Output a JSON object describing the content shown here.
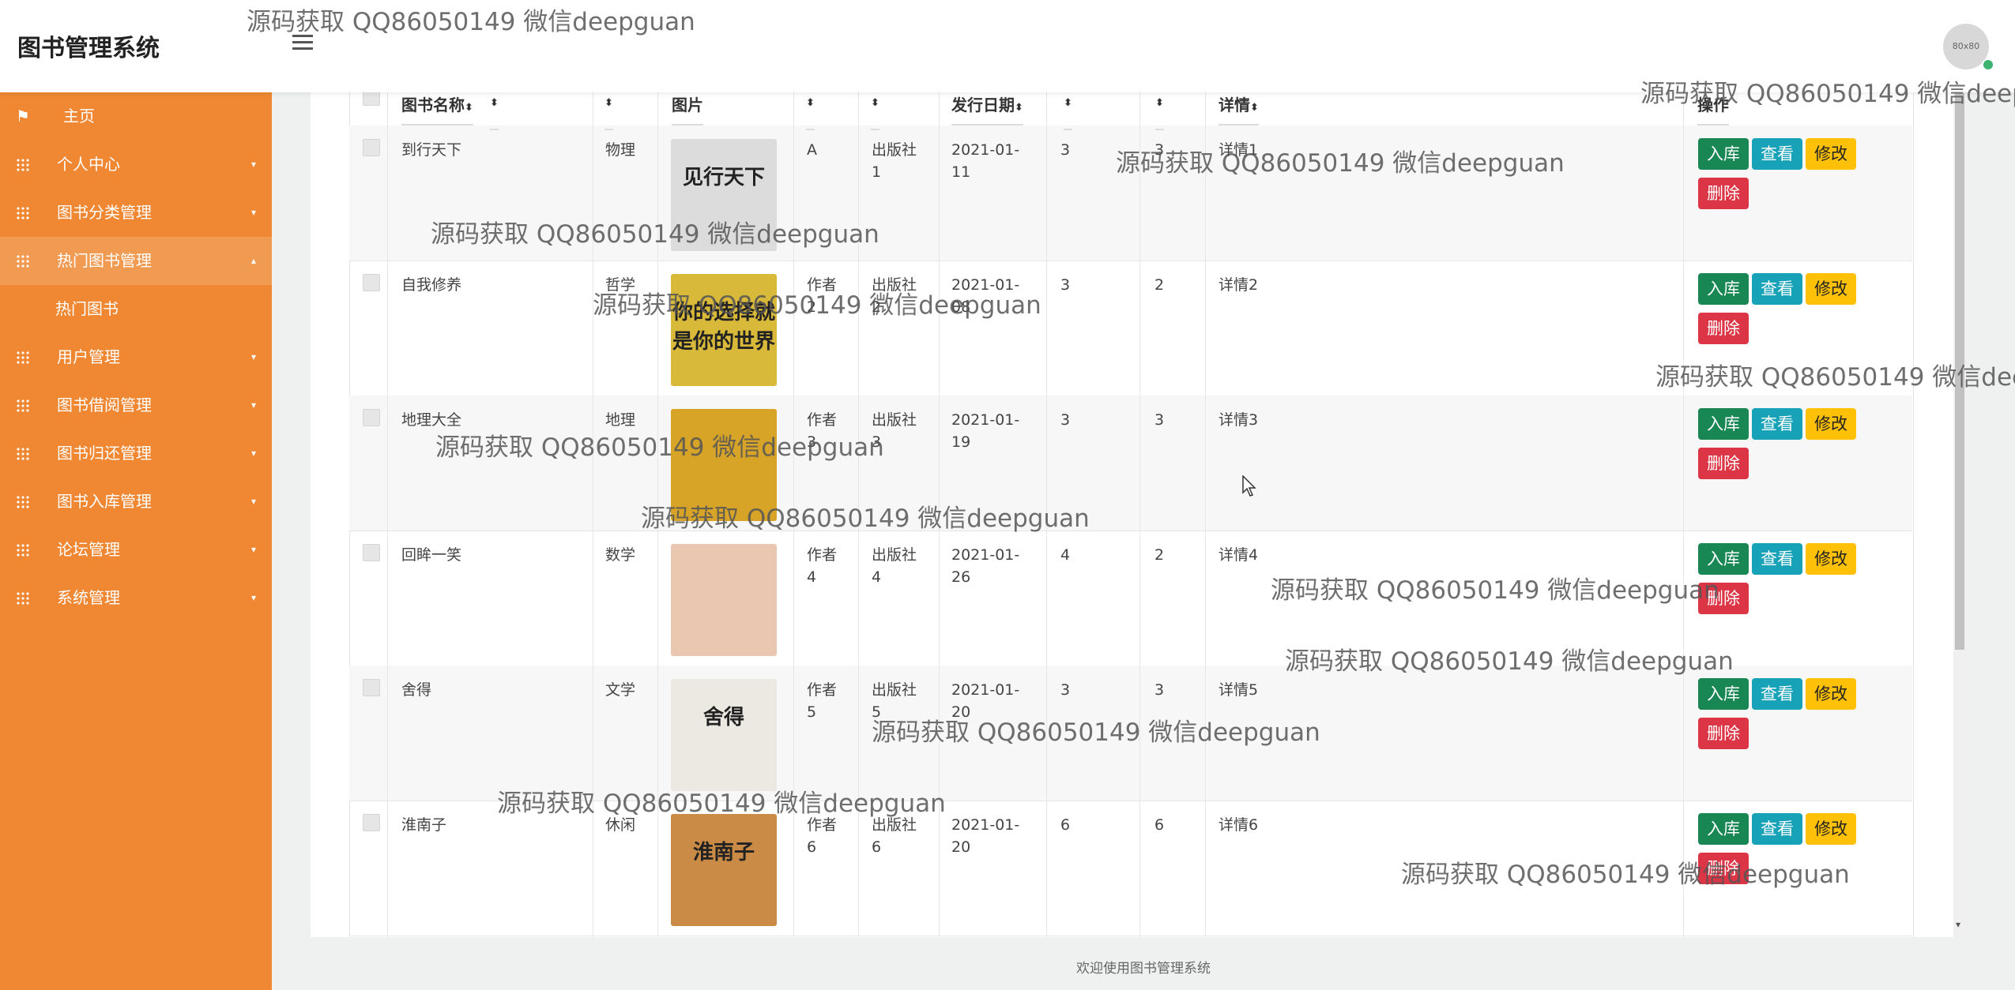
{
  "header": {
    "app_title": "图书管理系统",
    "avatar_text": "80x80"
  },
  "sidebar": {
    "items": [
      {
        "label": "主页"
      },
      {
        "label": "个人中心"
      },
      {
        "label": "图书分类管理"
      },
      {
        "label": "热门图书管理",
        "sub": "热门图书"
      },
      {
        "label": "用户管理"
      },
      {
        "label": "图书借阅管理"
      },
      {
        "label": "图书归还管理"
      },
      {
        "label": "图书入库管理"
      },
      {
        "label": "论坛管理"
      },
      {
        "label": "系统管理"
      }
    ]
  },
  "table": {
    "columns": [
      "图书名称",
      "",
      "图片",
      "",
      "",
      "发行日期",
      "",
      "",
      "详情",
      "操作"
    ],
    "rows": [
      {
        "name": "到行天下",
        "category": "物理",
        "author": "A",
        "publisher": "出版社\n1",
        "date": "2021-01-\n11",
        "n1": "3",
        "n2": "3",
        "detail": "详情1"
      },
      {
        "name": "自我修养",
        "category": "哲学",
        "author": "作者\n2",
        "publisher": "出版社\n2",
        "date": "2021-01-\n08",
        "n1": "3",
        "n2": "2",
        "detail": "详情2"
      },
      {
        "name": "地理大全",
        "category": "地理",
        "author": "作者\n3",
        "publisher": "出版社\n3",
        "date": "2021-01-\n19",
        "n1": "3",
        "n2": "3",
        "detail": "详情3"
      },
      {
        "name": "回眸一笑",
        "category": "数学",
        "author": "作者\n4",
        "publisher": "出版社\n4",
        "date": "2021-01-\n26",
        "n1": "4",
        "n2": "2",
        "detail": "详情4"
      },
      {
        "name": "舍得",
        "category": "文学",
        "author": "作者\n5",
        "publisher": "出版社\n5",
        "date": "2021-01-\n20",
        "n1": "3",
        "n2": "3",
        "detail": "详情5"
      },
      {
        "name": "淮南子",
        "category": "休闲",
        "author": "作者\n6",
        "publisher": "出版社\n6",
        "date": "2021-01-\n20",
        "n1": "6",
        "n2": "6",
        "detail": "详情6"
      }
    ],
    "covers": [
      {
        "color": "#dcdcdc",
        "text": "见行天下"
      },
      {
        "color": "#d9b93a",
        "text": "你的选择就是你的世界"
      },
      {
        "color": "#d7a428",
        "text": ""
      },
      {
        "color": "#e9c7b0",
        "text": ""
      },
      {
        "color": "#ece8e2",
        "text": "舍得"
      },
      {
        "color": "#c98b45",
        "text": "淮南子"
      }
    ]
  },
  "actions": {
    "in": "入库",
    "view": "查看",
    "edit": "修改",
    "delete": "删除"
  },
  "footer": {
    "text": "欢迎使用图书管理系统"
  },
  "watermark": {
    "text": "源码获取 QQ86050149 微信deepguan"
  },
  "colors": {
    "sidebar": "#ef8733",
    "btn_in": "#198754",
    "btn_view": "#17a2b8",
    "btn_edit": "#ffc107",
    "btn_delete": "#dc3545"
  }
}
